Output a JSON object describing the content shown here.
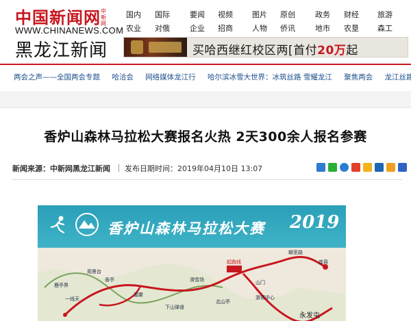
{
  "header": {
    "logo_text": "中国新闻网",
    "logo_side": "中新网",
    "logo_url": "WWW.CHINANEWS.COM",
    "site_name": "黑龙江新闻",
    "nav_columns": [
      [
        "国内",
        "农业"
      ],
      [
        "国际",
        "对俄"
      ],
      [
        "要闻",
        "企业"
      ],
      [
        "视频",
        "招商"
      ],
      [
        "图片",
        "人物"
      ],
      [
        "原创",
        "侨讯"
      ],
      [
        "政务",
        "地市"
      ],
      [
        "财经",
        "农垦"
      ],
      [
        "旅游",
        "森工"
      ]
    ],
    "banner": {
      "text_main": "买哈西继红校区两",
      "text_mid": "[首付",
      "text_amount": "20万",
      "text_end": "起"
    }
  },
  "subnav": {
    "items": [
      "两会之声——全国两会专题",
      "哈洽会",
      "网络媒体龙江行",
      "哈尔滨冰雪大世界：冰筑丝路 雪耀龙江",
      "聚焦两会",
      "龙江丝路带"
    ]
  },
  "article": {
    "headline": "香炉山森林马拉松大赛报名火热 2天300余人报名参赛",
    "source_label": "新闻来源：",
    "source": "中新网黑龙江新闻",
    "date_label": "发布日期时间：",
    "date": "2019年04月10日 13:07",
    "share_icons": [
      {
        "name": "plus-share-icon",
        "color": "#2e7bd0"
      },
      {
        "name": "wechat-icon",
        "color": "#2aae3a"
      },
      {
        "name": "qq-icon",
        "color": "#2a7ecf"
      },
      {
        "name": "weibo-icon",
        "color": "#e2402a"
      },
      {
        "name": "qzone-icon",
        "color": "#f2b21c"
      },
      {
        "name": "renren-icon",
        "color": "#1d66b3"
      },
      {
        "name": "star-icon",
        "color": "#f0a020"
      },
      {
        "name": "translate-icon",
        "color": "#2f63c4"
      }
    ]
  },
  "map": {
    "title": "香炉山森林马拉松大赛",
    "year": "2019",
    "labels": [
      "观景台",
      "香亭",
      "鹿亭界",
      "漏雾",
      "一线天",
      "滑雪场",
      "下山弹道",
      "永发屯",
      "宾县",
      "朝圣路",
      "游客中心",
      "起跑线",
      "山门",
      "北山亭"
    ],
    "colors": {
      "band": "#2a9fb8",
      "route": "#c8161e",
      "ground": "#f2ede4"
    }
  }
}
